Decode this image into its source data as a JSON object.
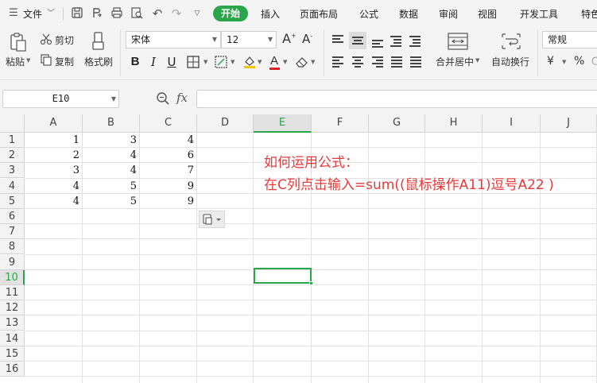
{
  "menubar": {
    "file": "文件",
    "tabs": [
      "开始",
      "插入",
      "页面布局",
      "公式",
      "数据",
      "审阅",
      "视图",
      "开发工具",
      "特色"
    ]
  },
  "ribbon": {
    "paste": "粘贴",
    "cut": "剪切",
    "copy": "复制",
    "format_painter": "格式刷",
    "font_name": "宋体",
    "font_size": "12",
    "merge_center": "合并居中",
    "wrap_text": "自动换行",
    "number_format": "常规",
    "currency": "¥",
    "percent": "%"
  },
  "formula_bar": {
    "name_box": "E10",
    "fx": "fx",
    "value": ""
  },
  "sheet": {
    "columns": [
      "A",
      "B",
      "C",
      "D",
      "E",
      "F",
      "G",
      "H",
      "I",
      "J"
    ],
    "selected_column": "E",
    "rows": [
      "1",
      "2",
      "3",
      "4",
      "5",
      "6",
      "7",
      "8",
      "9",
      "10",
      "11",
      "12",
      "13",
      "14",
      "15",
      "16"
    ],
    "selected_row": "10",
    "data": [
      [
        "1",
        "3",
        "4"
      ],
      [
        "2",
        "4",
        "6"
      ],
      [
        "3",
        "4",
        "7"
      ],
      [
        "4",
        "5",
        "9"
      ],
      [
        "4",
        "5",
        "9"
      ]
    ],
    "note_line1": "如何运用公式：",
    "note_line2": "在C列点击输入=sum((鼠标操作A11)逗号A22 )"
  },
  "colors": {
    "accent": "#2aa54a",
    "note": "#e83a3a",
    "font_color": "#e02020",
    "fill_color": "#f5c400"
  }
}
